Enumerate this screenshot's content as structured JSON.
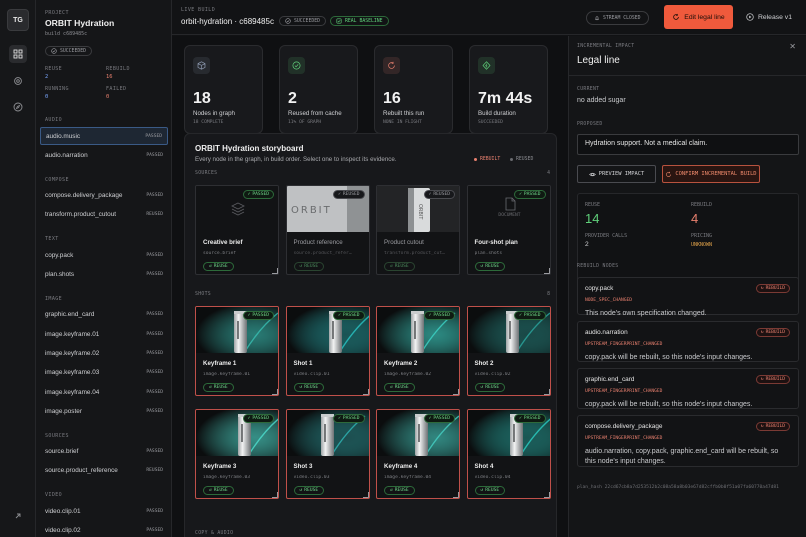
{
  "rail": {
    "avatar": "TG",
    "icons": [
      "grid-icon",
      "settings-icon",
      "compass-icon",
      "expand-icon"
    ]
  },
  "sidebar": {
    "project_label": "PROJECT",
    "project_name": "ORBIT Hydration",
    "build_id": "build c689485c",
    "status": "SUCCEEDED",
    "stats": [
      {
        "k": "REUSE",
        "v": "2"
      },
      {
        "k": "REBUILD",
        "v": "16"
      },
      {
        "k": "RUNNING",
        "v": "0"
      },
      {
        "k": "FAILED",
        "v": "0"
      }
    ],
    "groups": [
      {
        "label": "AUDIO",
        "items": [
          {
            "name": "audio.music",
            "status": "PASSED",
            "selected": true
          },
          {
            "name": "audio.narration",
            "status": "PASSED"
          }
        ]
      },
      {
        "label": "COMPOSE",
        "items": [
          {
            "name": "compose.delivery_package",
            "status": "PASSED"
          },
          {
            "name": "transform.product_cutout",
            "status": "REUSED"
          }
        ]
      },
      {
        "label": "TEXT",
        "items": [
          {
            "name": "copy.pack",
            "status": "PASSED"
          },
          {
            "name": "plan.shots",
            "status": "PASSED"
          }
        ]
      },
      {
        "label": "IMAGE",
        "items": [
          {
            "name": "graphic.end_card",
            "status": "PASSED"
          },
          {
            "name": "image.keyframe.01",
            "status": "PASSED"
          },
          {
            "name": "image.keyframe.02",
            "status": "PASSED"
          },
          {
            "name": "image.keyframe.03",
            "status": "PASSED"
          },
          {
            "name": "image.keyframe.04",
            "status": "PASSED"
          },
          {
            "name": "image.poster",
            "status": "PASSED"
          }
        ]
      },
      {
        "label": "SOURCES",
        "items": [
          {
            "name": "source.brief",
            "status": "PASSED"
          },
          {
            "name": "source.product_reference",
            "status": "REUSED"
          }
        ]
      },
      {
        "label": "VIDEO",
        "items": [
          {
            "name": "video.clip.01",
            "status": "PASSED"
          },
          {
            "name": "video.clip.02",
            "status": "PASSED"
          },
          {
            "name": "video.clip.03",
            "status": "PASSED"
          }
        ]
      }
    ]
  },
  "topbar": {
    "eyebrow": "LIVE BUILD",
    "title": "orbit-hydration · c689485c",
    "status": "SUCCEEDED",
    "baseline": "REAL BASELINE",
    "stream": "STREAM CLOSED",
    "edit_btn": "Edit legal line",
    "release_btn": "Release v1"
  },
  "stats": [
    {
      "num": "18",
      "label": "Nodes in graph",
      "sub": "18 COMPLETE",
      "icon": "cube-icon",
      "color": "#8e9ab0"
    },
    {
      "num": "2",
      "label": "Reused from cache",
      "sub": "11% OF GRAPH",
      "icon": "check-circle-icon",
      "color": "#5fd07a"
    },
    {
      "num": "16",
      "label": "Rebuilt this run",
      "sub": "NONE IN FLIGHT",
      "icon": "refresh-icon",
      "color": "#e9806f"
    },
    {
      "num": "7m 44s",
      "label": "Build duration",
      "sub": "SUCCEEDED",
      "icon": "lightning-icon",
      "color": "#5fd07a"
    }
  ],
  "storyboard": {
    "title": "ORBIT Hydration storyboard",
    "desc": "Every node in the graph, in build order. Select one to inspect its evidence.",
    "legend_rebuilt": "REBUILT",
    "legend_reused": "REUSED",
    "sections": [
      {
        "label": "SOURCES",
        "count": "4",
        "cards": [
          {
            "title": "Creative brief",
            "id": "source.brief",
            "badge": "PASSED",
            "thumb": "brief"
          },
          {
            "title": "Product reference",
            "id": "source.product_refer…",
            "badge": "REUSED",
            "thumb": "ref",
            "dim": true
          },
          {
            "title": "Product cutout",
            "id": "transform.product_cut…",
            "badge": "REUSED",
            "thumb": "cutout",
            "dim": true
          },
          {
            "title": "Four-shot plan",
            "id": "plan.shots",
            "badge": "PASSED",
            "thumb": "doc",
            "thumb_text": "DOCUMENT"
          }
        ]
      },
      {
        "label": "SHOTS",
        "count": "8",
        "cards": [
          {
            "title": "Keyframe 1",
            "id": "image.keyframe.01",
            "badge": "PASSED",
            "thumb": "can1"
          },
          {
            "title": "Shot 1",
            "id": "video.clip.01",
            "badge": "PASSED",
            "thumb": "can2"
          },
          {
            "title": "Keyframe 2",
            "id": "image.keyframe.02",
            "badge": "PASSED",
            "thumb": "can3"
          },
          {
            "title": "Shot 2",
            "id": "video.clip.02",
            "badge": "PASSED",
            "thumb": "can4"
          },
          {
            "title": "Keyframe 3",
            "id": "image.keyframe.03",
            "badge": "PASSED",
            "thumb": "can5"
          },
          {
            "title": "Shot 3",
            "id": "video.clip.03",
            "badge": "PASSED",
            "thumb": "can6"
          },
          {
            "title": "Keyframe 4",
            "id": "image.keyframe.04",
            "badge": "PASSED",
            "thumb": "can7"
          },
          {
            "title": "Shot 4",
            "id": "video.clip.04",
            "badge": "PASSED",
            "thumb": "can8"
          }
        ]
      }
    ],
    "reuse_label": "REUSE",
    "next_section": "COPY & AUDIO"
  },
  "panel": {
    "eyebrow": "INCREMENTAL IMPACT",
    "title": "Legal line",
    "current_label": "CURRENT",
    "current_value": "no added sugar",
    "proposed_label": "PROPOSED",
    "proposed_value": "Hydration support. Not a medical claim.",
    "preview_btn": "PREVIEW IMPACT",
    "confirm_btn": "CONFIRM INCREMENTAL BUILD",
    "reuse_label": "REUSE",
    "reuse_value": "14",
    "rebuild_label": "REBUILD",
    "rebuild_value": "4",
    "provider_label": "PROVIDER CALLS",
    "provider_value": "2",
    "pricing_label": "PRICING",
    "pricing_value": "UNKNOWN",
    "nodes_label": "REBUILD NODES",
    "nodes": [
      {
        "name": "copy.pack",
        "reason": "NODE_SPEC_CHANGED",
        "desc": "This node's own specification changed.",
        "tag": "REBUILD"
      },
      {
        "name": "audio.narration",
        "reason": "UPSTREAM_FINGERPRINT_CHANGED",
        "desc": "copy.pack will be rebuilt, so this node's input changes.",
        "tag": "REBUILD"
      },
      {
        "name": "graphic.end_card",
        "reason": "UPSTREAM_FINGERPRINT_CHANGED",
        "desc": "copy.pack will be rebuilt, so this node's input changes.",
        "tag": "REBUILD"
      },
      {
        "name": "compose.delivery_package",
        "reason": "UPSTREAM_FINGERPRINT_CHANGED",
        "desc": "audio.narration, copy.pack, graphic.end_card will be rebuilt, so this node's input changes.",
        "tag": "REBUILD"
      }
    ],
    "plan_hash": "plan_hash 22cd67cb8a7d253512b2c08a58a8b03e67d82cffb0b0f51a07fa60770a47d81"
  },
  "colors": {
    "accent": "#ef5a3c",
    "passed": "#5fd07a",
    "rebuild": "#e9806f",
    "selected": "#3a5a86"
  }
}
